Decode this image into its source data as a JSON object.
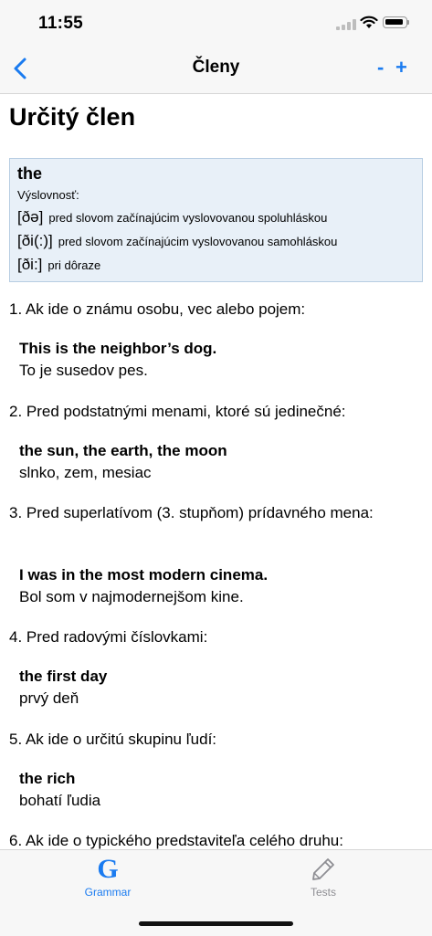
{
  "status_bar": {
    "time": "11:55"
  },
  "nav": {
    "title": "Členy",
    "minus_label": "-",
    "plus_label": "+",
    "back_icon": "chevron-left-icon"
  },
  "page": {
    "title": "Určitý člen",
    "pronunciation": {
      "word": "the",
      "caption": "Výslovnosť:",
      "rows": [
        {
          "ipa": "[ðə]",
          "note": "pred slovom začínajúcim vyslovovanou spoluhláskou"
        },
        {
          "ipa": "[ði(:)]",
          "note": "pred slovom začínajúcim vyslovovanou samohláskou"
        },
        {
          "ipa": "[ði:]",
          "note": "pri dôraze"
        }
      ]
    },
    "rules": [
      {
        "text": "1. Ak ide o známu osobu, vec alebo pojem:",
        "example_en": "This is the neighbor’s dog.",
        "example_sk": "To je susedov pes."
      },
      {
        "text": "2. Pred podstatnými menami, ktoré sú jedinečné:",
        "example_en": "the sun, the earth, the moon",
        "example_sk": "slnko, zem, mesiac"
      },
      {
        "text": "3. Pred superlatívom (3. stupňom) prídavného mena:",
        "example_en": "I was in the most modern cinema.",
        "example_sk": "Bol som v najmodernejšom kine."
      },
      {
        "text": "4. Pred radovými číslovkami:",
        "example_en": "the first day",
        "example_sk": "prvý deň"
      },
      {
        "text": "5. Ak ide o určitú skupinu ľudí:",
        "example_en": "the rich",
        "example_sk": "bohatí ľudia"
      },
      {
        "text": "6. Ak ide o typického predstaviteľa celého druhu:"
      }
    ]
  },
  "tab_bar": {
    "tabs": [
      {
        "label": "Grammar",
        "icon": "grammar-g-icon",
        "glyph": "G",
        "active": true
      },
      {
        "label": "Tests",
        "icon": "pencil-icon",
        "active": false
      }
    ]
  },
  "colors": {
    "accent": "#1a7bf0",
    "inactive": "#8e8e93",
    "pron_box_bg": "#e8f0f8"
  }
}
